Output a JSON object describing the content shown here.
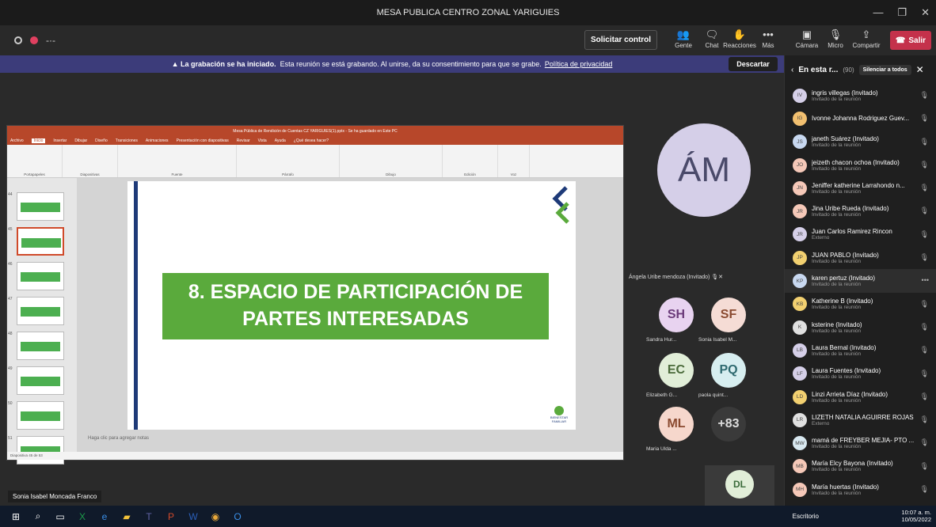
{
  "window": {
    "title": "MESA PUBLICA CENTRO ZONAL YARIGUIES"
  },
  "toolbar": {
    "request_control": "Solicitar control",
    "people": "Gente",
    "chat": "Chat",
    "reactions": "Reacciones",
    "more": "Más",
    "camera": "Cámara",
    "mic": "Micro",
    "share": "Compartir",
    "leave": "Salir",
    "people_badge": "1"
  },
  "banner": {
    "bold": "La grabación se ha iniciado.",
    "text": "Esta reunión se está grabando. Al unirse, da su consentimiento para que se grabe.",
    "link": "Política de privacidad",
    "dismiss": "Descartar"
  },
  "ppt": {
    "title": "Mesa Pública de Rendición de Cuentas CZ YARIGUIES(1).pptx - Se ha guardado en Este PC",
    "user": "Sonia Isabel Moncada Franco",
    "tabs": [
      "Archivo",
      "Inicio",
      "Insertar",
      "Dibujar",
      "Diseño",
      "Transiciones",
      "Animaciones",
      "Presentación con diapositivas",
      "Revisar",
      "Vista",
      "Ayuda",
      "¿Qué desea hacer?"
    ],
    "groups": [
      "Portapapeles",
      "Diapositivas",
      "Fuente",
      "Párrafo",
      "Dibujo",
      "Edición",
      "Voz"
    ],
    "thumb_numbers": [
      "44",
      "45",
      "46",
      "47",
      "48",
      "49",
      "50",
      "51"
    ],
    "slide_title": "8. ESPACIO DE PARTICIPACIÓN DE PARTES INTERESADAS",
    "notes": "Haga clic para agregar notas",
    "status": "Diapositiva 45 de 53",
    "logo_text": "BIENESTAR FAMILIAR"
  },
  "presenter": "Sonia Isabel Moncada Franco",
  "big_tile": {
    "initials": "ÁM",
    "name": "Ángela Uribe mendoza (Invitado)"
  },
  "tiles": [
    {
      "initials": "SH",
      "name": "Sandra Hur...",
      "color": "#e8d3f0",
      "fg": "#6b3b7a"
    },
    {
      "initials": "SF",
      "name": "Sonia Isabel M...",
      "color": "#f5dcd5",
      "fg": "#8a4a30"
    },
    {
      "initials": "EC",
      "name": "Elizabeth G...",
      "color": "#e1eed8",
      "fg": "#4a6a3a"
    },
    {
      "initials": "PQ",
      "name": "paola quint...",
      "color": "#d7eef0",
      "fg": "#2f6a70"
    },
    {
      "initials": "ML",
      "name": "Maria Ulda ...",
      "color": "#f6d7cc",
      "fg": "#8a4a30"
    },
    {
      "initials": "+83",
      "name": "",
      "color": "#3a3a3a",
      "fg": "#ddd"
    }
  ],
  "dl": {
    "initials": "DL"
  },
  "panel": {
    "title": "En esta r...",
    "count": "(90)",
    "silence": "Silenciar a todos"
  },
  "participants": [
    {
      "i": "IV",
      "name": "ingris villegas (Invitado)",
      "sub": "Invitado de la reunión",
      "c": "#d5cfe8"
    },
    {
      "i": "IG",
      "name": "Ivonne Johanna Rodriguez Guev...",
      "sub": "",
      "c": "#f2c070"
    },
    {
      "i": "JS",
      "name": "janeth Suárez (Invitado)",
      "sub": "Invitado de la reunión",
      "c": "#c8d8f0"
    },
    {
      "i": "JO",
      "name": "jeizeth chacon ochoa (Invitado)",
      "sub": "Invitado de la reunión",
      "c": "#f5c8b8"
    },
    {
      "i": "JN",
      "name": "Jeniffer katherine Larrahondo n...",
      "sub": "Invitado de la reunión",
      "c": "#f5c8b8"
    },
    {
      "i": "JR",
      "name": "Jina Uribe Rueda (Invitado)",
      "sub": "Invitado de la reunión",
      "c": "#f5c8b8"
    },
    {
      "i": "JR",
      "name": "Juan Carlos Ramirez Rincon",
      "sub": "Externo",
      "c": "#d5cfe8"
    },
    {
      "i": "JP",
      "name": "JUAN PABLO (Invitado)",
      "sub": "Invitado de la reunión",
      "c": "#f2d070"
    },
    {
      "i": "KP",
      "name": "karen pertuz (Invitado)",
      "sub": "Invitado de la reunión",
      "c": "#c8d8f0"
    },
    {
      "i": "KB",
      "name": "Katherine B (Invitado)",
      "sub": "Invitado de la reunión",
      "c": "#f2d070"
    },
    {
      "i": "K",
      "name": "ksterine (Invitado)",
      "sub": "Invitado de la reunión",
      "c": "#e0e0e0"
    },
    {
      "i": "LB",
      "name": "Laura Bernal (Invitado)",
      "sub": "Invitado de la reunión",
      "c": "#d5cfe8"
    },
    {
      "i": "LF",
      "name": "Laura Fuentes (Invitado)",
      "sub": "Invitado de la reunión",
      "c": "#d5cfe8"
    },
    {
      "i": "LD",
      "name": "Linzi Arrieta Díaz (Invitado)",
      "sub": "Invitado de la reunión",
      "c": "#f2d070"
    },
    {
      "i": "LR",
      "name": "LIZETH NATALIA AGUIRRE ROJAS",
      "sub": "Externo",
      "c": "#e0e0e0"
    },
    {
      "i": "MW",
      "name": "mamá de FREYBER MEJIA- PTO ...",
      "sub": "Invitado de la reunión",
      "c": "#d8e8f0"
    },
    {
      "i": "MB",
      "name": "María Elcy Bayona (Invitado)",
      "sub": "Invitado de la reunión",
      "c": "#f5c8b8"
    },
    {
      "i": "MH",
      "name": "María huertas (Invitado)",
      "sub": "Invitado de la reunión",
      "c": "#f5c8b8"
    }
  ],
  "taskbar": {
    "desktop": "Escritorio",
    "time": "10:07 a. m.",
    "date": "10/05/2022"
  }
}
